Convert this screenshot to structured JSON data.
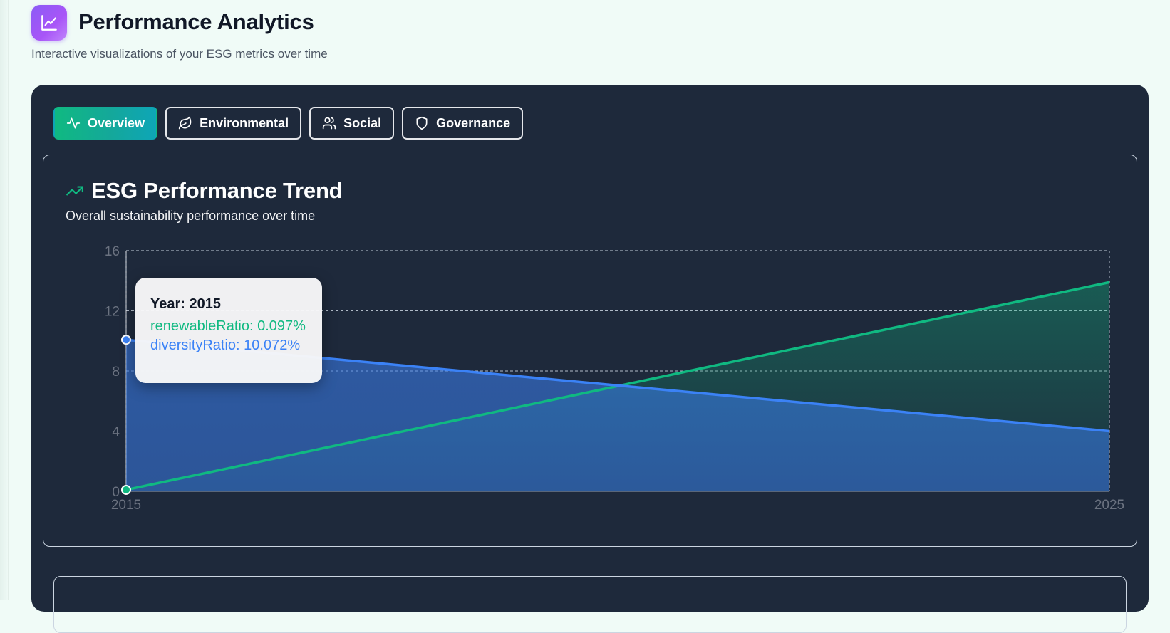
{
  "header": {
    "title": "Performance Analytics",
    "subtitle": "Interactive visualizations of your ESG metrics over time",
    "logo_icon": "line-chart-icon",
    "logo_color": "#8b5cf6"
  },
  "tabs": [
    {
      "label": "Overview",
      "icon": "activity-icon",
      "active": true
    },
    {
      "label": "Environmental",
      "icon": "leaf-icon",
      "active": false
    },
    {
      "label": "Social",
      "icon": "users-icon",
      "active": false
    },
    {
      "label": "Governance",
      "icon": "shield-icon",
      "active": false
    }
  ],
  "card": {
    "title": "ESG Performance Trend",
    "title_icon": "trending-up-icon",
    "subtitle": "Overall sustainability performance over time"
  },
  "tooltip": {
    "year_label": "Year: 2015",
    "rows": [
      {
        "text": "renewableRatio: 0.097%",
        "color": "#10b981"
      },
      {
        "text": "diversityRatio: 10.072%",
        "color": "#3b82f6"
      }
    ]
  },
  "chart_data": {
    "type": "area",
    "x": [
      2015,
      2025
    ],
    "x_ticks": [
      "2015",
      "2025"
    ],
    "y_ticks": [
      "0",
      "4",
      "8",
      "12",
      "16"
    ],
    "ylim": [
      0,
      16
    ],
    "grid": true,
    "series": [
      {
        "name": "renewableRatio",
        "values": [
          0.097,
          13.9
        ],
        "color": "#10b981"
      },
      {
        "name": "diversityRatio",
        "values": [
          10.072,
          4.0
        ],
        "color": "#3b82f6"
      }
    ],
    "active_x": 2015
  }
}
